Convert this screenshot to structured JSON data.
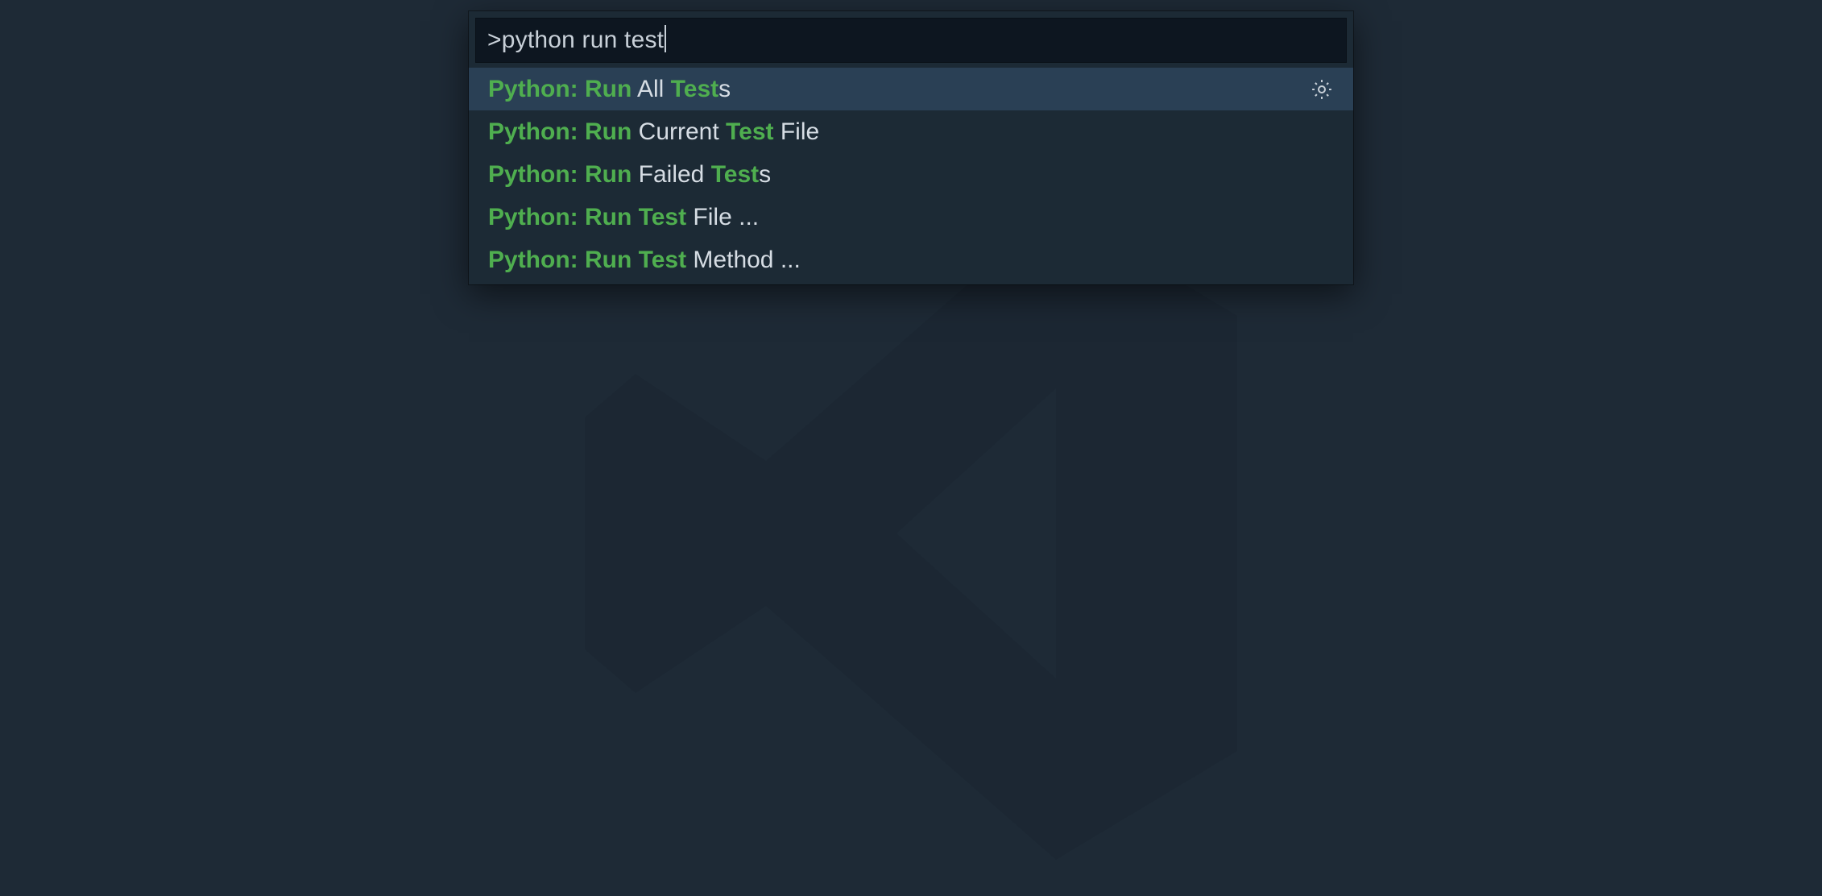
{
  "search": {
    "prefix": ">",
    "query": "python run test"
  },
  "results": [
    {
      "selected": true,
      "has_gear": true,
      "segments": [
        {
          "t": "Python: Run",
          "hl": true
        },
        {
          "t": " All ",
          "hl": false
        },
        {
          "t": "Test",
          "hl": true
        },
        {
          "t": "s",
          "hl": false
        }
      ]
    },
    {
      "selected": false,
      "has_gear": false,
      "segments": [
        {
          "t": "Python: Run",
          "hl": true
        },
        {
          "t": " Current ",
          "hl": false
        },
        {
          "t": "Test",
          "hl": true
        },
        {
          "t": " File",
          "hl": false
        }
      ]
    },
    {
      "selected": false,
      "has_gear": false,
      "segments": [
        {
          "t": "Python: Run",
          "hl": true
        },
        {
          "t": " Failed ",
          "hl": false
        },
        {
          "t": "Test",
          "hl": true
        },
        {
          "t": "s",
          "hl": false
        }
      ]
    },
    {
      "selected": false,
      "has_gear": false,
      "segments": [
        {
          "t": "Python: Run Test",
          "hl": true
        },
        {
          "t": " File ...",
          "hl": false
        }
      ]
    },
    {
      "selected": false,
      "has_gear": false,
      "segments": [
        {
          "t": "Python: Run Test",
          "hl": true
        },
        {
          "t": " Method ...",
          "hl": false
        }
      ]
    }
  ]
}
